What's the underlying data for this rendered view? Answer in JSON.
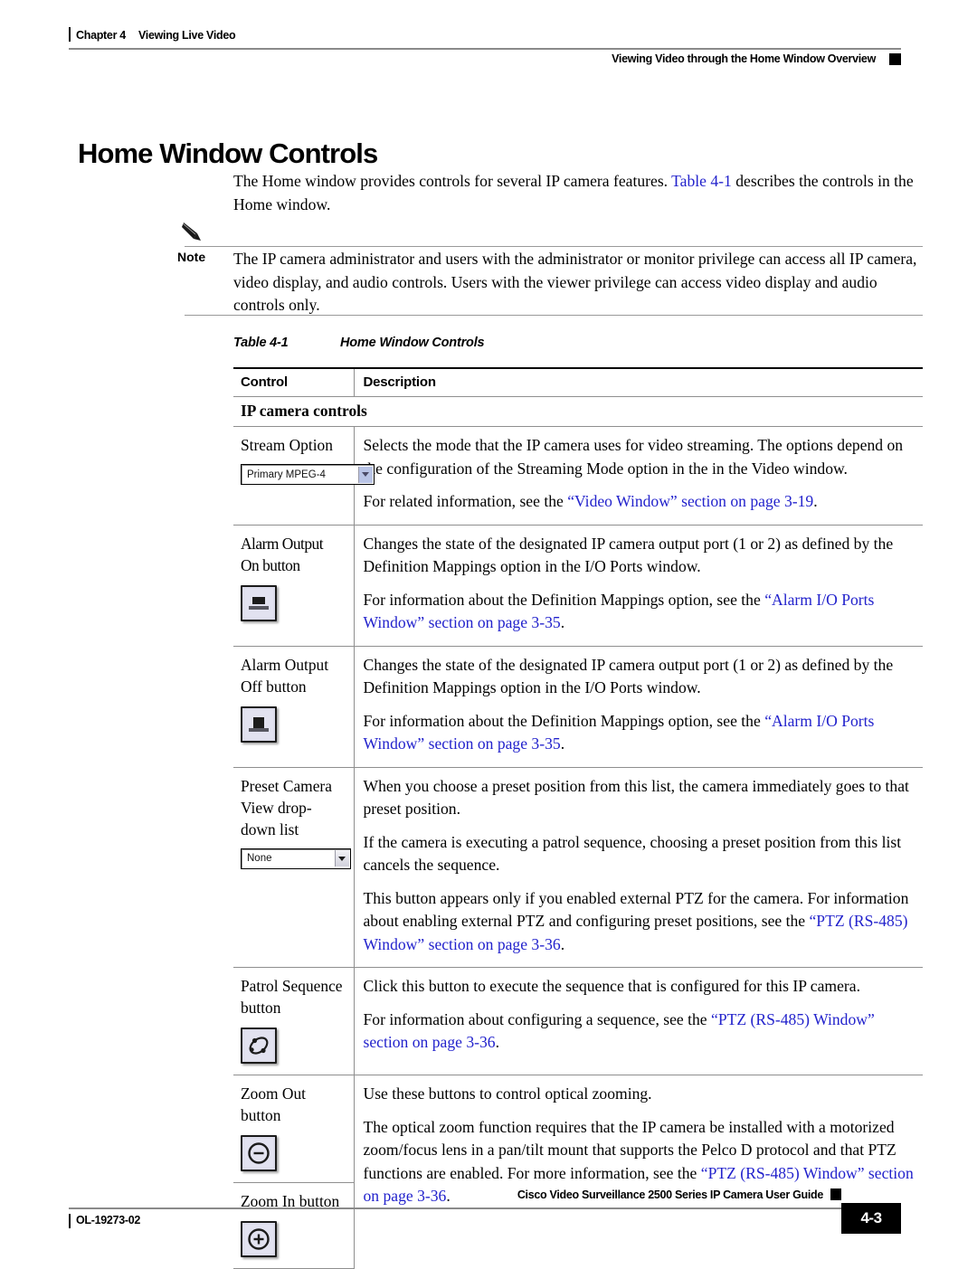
{
  "header": {
    "chapter": "Chapter 4",
    "chapter_title": "Viewing Live Video",
    "section": "Viewing Video through the Home Window Overview"
  },
  "page_title": "Home Window Controls",
  "intro": {
    "before_link": "The Home window provides controls for several IP camera features. ",
    "link": "Table 4-1",
    "after_link": " describes the controls in the Home window."
  },
  "note": {
    "label": "Note",
    "text": "The IP camera administrator and users with the administrator or monitor privilege can access all IP camera, video display, and audio controls. Users with the viewer privilege can access video display and audio controls only."
  },
  "table": {
    "caption_number": "Table 4-1",
    "caption_title": "Home Window Controls",
    "columns": [
      "Control",
      "Description"
    ],
    "group_heading": "IP camera controls",
    "rows": [
      {
        "control": "Stream Option",
        "widget": {
          "type": "select",
          "value": "Primary MPEG-4"
        },
        "paragraphs": [
          {
            "parts": [
              {
                "text": "Selects the mode that the IP camera uses for video streaming. The options depend on the configuration of the Streaming Mode option in the in the Video window.",
                "link": false
              }
            ]
          },
          {
            "parts": [
              {
                "text": "For related information, see the ",
                "link": false
              },
              {
                "text": "“Video Window” section on page 3-19",
                "link": true
              },
              {
                "text": ".",
                "link": false
              }
            ]
          }
        ]
      },
      {
        "control": "Alarm Output On button",
        "widget": {
          "type": "button",
          "icon": "alarm-output-on-icon"
        },
        "paragraphs": [
          {
            "parts": [
              {
                "text": "Changes the state of the designated IP camera output port (1 or 2) as defined by the Definition Mappings option in the I/O Ports window.",
                "link": false
              }
            ]
          },
          {
            "parts": [
              {
                "text": "For information about the Definition Mappings option, see the ",
                "link": false
              },
              {
                "text": "“Alarm I/O Ports Window” section on page 3-35",
                "link": true
              },
              {
                "text": ".",
                "link": false
              }
            ]
          }
        ]
      },
      {
        "control": "Alarm Output Off button",
        "widget": {
          "type": "button",
          "icon": "alarm-output-off-icon"
        },
        "paragraphs": [
          {
            "parts": [
              {
                "text": "Changes the state of the designated IP camera output port (1 or 2) as defined by the Definition Mappings option in the I/O Ports window.",
                "link": false
              }
            ]
          },
          {
            "parts": [
              {
                "text": "For information about the Definition Mappings option, see the ",
                "link": false
              },
              {
                "text": "“Alarm I/O Ports Window” section on page 3-35",
                "link": true
              },
              {
                "text": ".",
                "link": false
              }
            ]
          }
        ]
      },
      {
        "control": "Preset Camera View drop-down list",
        "widget": {
          "type": "select",
          "value": "None"
        },
        "paragraphs": [
          {
            "parts": [
              {
                "text": "When you choose a preset position from this list, the camera immediately goes to that preset position.",
                "link": false
              }
            ]
          },
          {
            "parts": [
              {
                "text": "If the camera is executing a patrol sequence, choosing a preset position from this list cancels the sequence.",
                "link": false
              }
            ]
          },
          {
            "parts": [
              {
                "text": "This button appears only if you enabled external PTZ for the camera. For information about enabling external PTZ and configuring preset positions, see the ",
                "link": false
              },
              {
                "text": "“PTZ (RS-485) Window” section on page 3-36",
                "link": true
              },
              {
                "text": ".",
                "link": false
              }
            ]
          }
        ]
      },
      {
        "control": "Patrol Sequence button",
        "widget": {
          "type": "button",
          "icon": "patrol-sequence-icon"
        },
        "paragraphs": [
          {
            "parts": [
              {
                "text": "Click this button to execute the sequence that is configured for this IP camera.",
                "link": false
              }
            ]
          },
          {
            "parts": [
              {
                "text": "For information about configuring a sequence, see the ",
                "link": false
              },
              {
                "text": "“PTZ (RS-485) Window” section on page 3-36",
                "link": true
              },
              {
                "text": ".",
                "link": false
              }
            ]
          }
        ]
      },
      {
        "control": "Zoom Out button",
        "widget": {
          "type": "button",
          "icon": "zoom-out-icon"
        },
        "paragraphs": [
          {
            "parts": [
              {
                "text": "Use these buttons to control optical zooming.",
                "link": false
              }
            ]
          },
          {
            "parts": [
              {
                "text": "The optical zoom function requires that the IP camera be installed with a motorized zoom/focus lens in a pan/tilt mount that supports the Pelco D protocol and that PTZ functions are enabled. For more information, see the ",
                "link": false
              },
              {
                "text": "“PTZ (RS-485) Window” section on page 3-36",
                "link": true
              },
              {
                "text": ".",
                "link": false
              }
            ]
          }
        ]
      },
      {
        "control": "Zoom In button",
        "widget": {
          "type": "button",
          "icon": "zoom-in-icon"
        },
        "paragraphs": []
      }
    ]
  },
  "footer": {
    "guide_title": "Cisco Video Surveillance 2500 Series IP Camera User Guide",
    "doc_id": "OL-19273-02",
    "page_number": "4-3"
  },
  "colors": {
    "link": "#2222cc",
    "rule": "#8f8f8f",
    "button_face": "#dcdcea"
  }
}
